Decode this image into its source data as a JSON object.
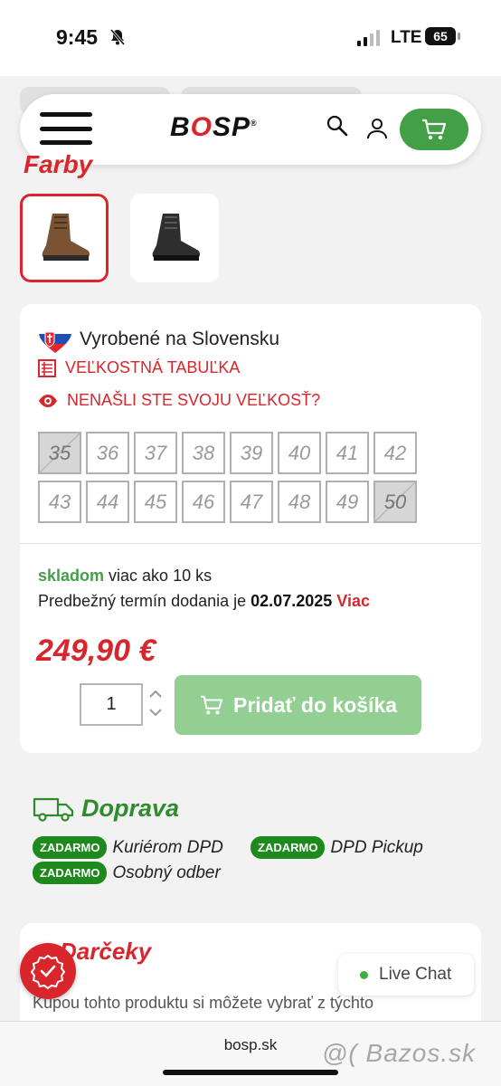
{
  "status": {
    "time": "9:45",
    "network": "LTE",
    "battery": "65"
  },
  "header": {
    "logo_left": "B",
    "logo_o": "O",
    "logo_right": "SP",
    "logo_reg": "®"
  },
  "colors": {
    "title": "Farby",
    "variants": [
      {
        "name": "brown-boot",
        "selected": true
      },
      {
        "name": "black-boot",
        "selected": false
      }
    ]
  },
  "product": {
    "made_in": "Vyrobené na Slovensku",
    "size_table": "Veľkostná tabuľka",
    "size_missing": "Nenašli ste svoju veľkosť?",
    "sizes": [
      {
        "label": "35",
        "available": false
      },
      {
        "label": "36",
        "available": true
      },
      {
        "label": "37",
        "available": true
      },
      {
        "label": "38",
        "available": true
      },
      {
        "label": "39",
        "available": true
      },
      {
        "label": "40",
        "available": true
      },
      {
        "label": "41",
        "available": true
      },
      {
        "label": "42",
        "available": true
      },
      {
        "label": "43",
        "available": true
      },
      {
        "label": "44",
        "available": true
      },
      {
        "label": "45",
        "available": true
      },
      {
        "label": "46",
        "available": true
      },
      {
        "label": "47",
        "available": true
      },
      {
        "label": "48",
        "available": true
      },
      {
        "label": "49",
        "available": true
      },
      {
        "label": "50",
        "available": false
      }
    ],
    "stock_status": "skladom",
    "stock_text": " viac ako 10 ks",
    "delivery_prefix": "Predbežný termín dodania je ",
    "delivery_date": "02.07.2025",
    "delivery_more": "Viac",
    "price": "249,90 €",
    "quantity": "1",
    "add_to_cart": "Pridať do košíka"
  },
  "shipping": {
    "title": "Doprava",
    "badge": "ZADARMO",
    "options": [
      "Kuriérom DPD",
      "DPD Pickup",
      "Osobný odber"
    ]
  },
  "gifts": {
    "title": "Darčeky",
    "text": "Kúpou tohto produktu si môžete vybrať z týchto"
  },
  "chat": {
    "label": "Live Chat"
  },
  "browser": {
    "url": "bosp.sk",
    "watermark": "@( Bazos.sk"
  }
}
